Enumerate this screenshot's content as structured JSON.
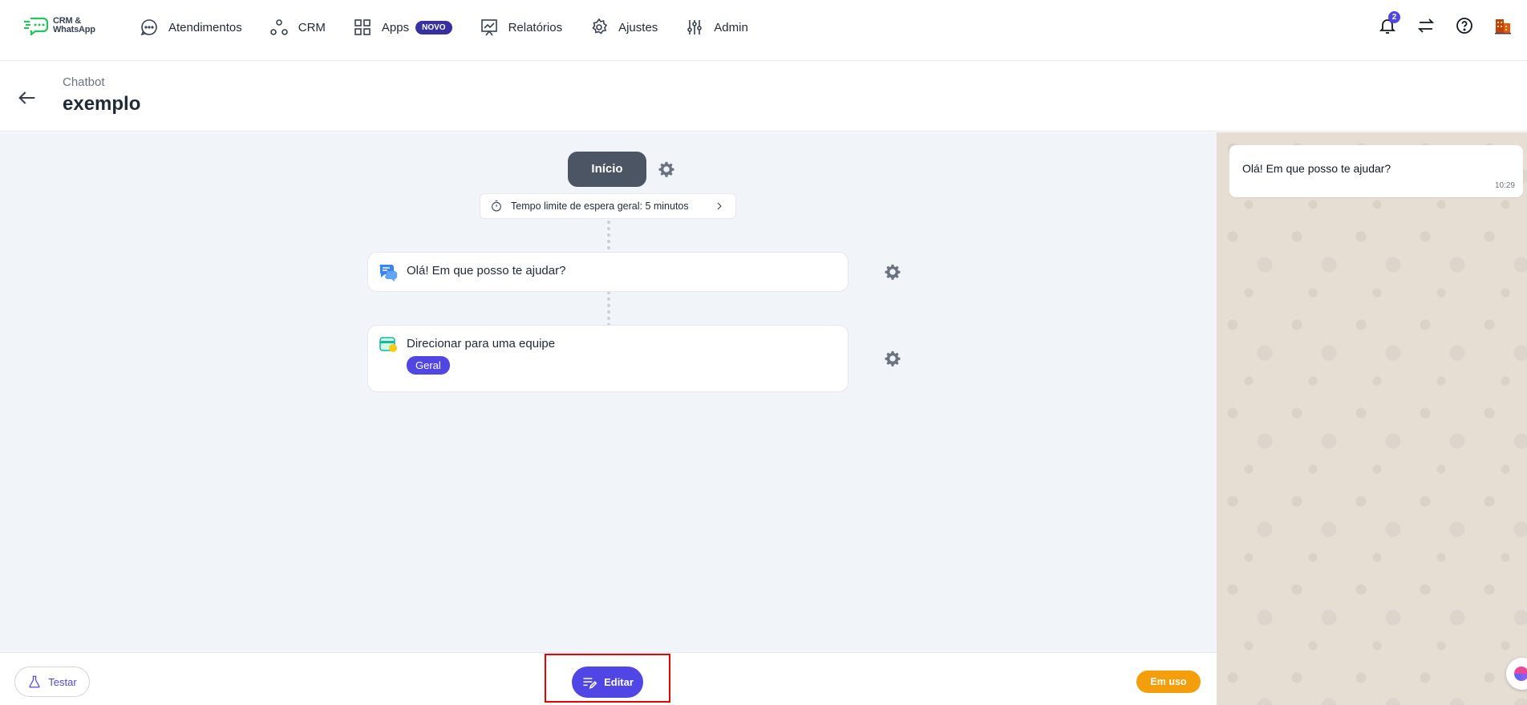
{
  "brand": {
    "line1": "CRM &",
    "line2": "WhatsApp",
    "color": "#22c55e"
  },
  "nav": {
    "items": [
      {
        "label": "Atendimentos",
        "icon": "chat-bubble-icon"
      },
      {
        "label": "CRM",
        "icon": "crm-nodes-icon"
      },
      {
        "label": "Apps",
        "icon": "apps-grid-icon",
        "badge": "NOVO"
      },
      {
        "label": "Relatórios",
        "icon": "report-chart-icon"
      },
      {
        "label": "Ajustes",
        "icon": "gear-icon"
      },
      {
        "label": "Admin",
        "icon": "sliders-icon"
      }
    ],
    "notifications": "2"
  },
  "header": {
    "breadcrumb": "Chatbot",
    "title": "exemplo"
  },
  "flow": {
    "start_label": "Início",
    "timeout_label": "Tempo limite de espera geral: 5 minutos",
    "message_node": "Olá! Em que posso te ajudar?",
    "route_node": "Direcionar para uma equipe",
    "route_team": "Geral"
  },
  "bottom": {
    "test_label": "Testar",
    "edit_label": "Editar",
    "status_label": "Em uso"
  },
  "preview": {
    "message": "Olá! Em que posso te ajudar?",
    "time": "10:29"
  },
  "colors": {
    "accent": "#4f46e5",
    "status": "#f59e0b",
    "start_node": "#4b5563",
    "highlight": "#ee0000"
  }
}
